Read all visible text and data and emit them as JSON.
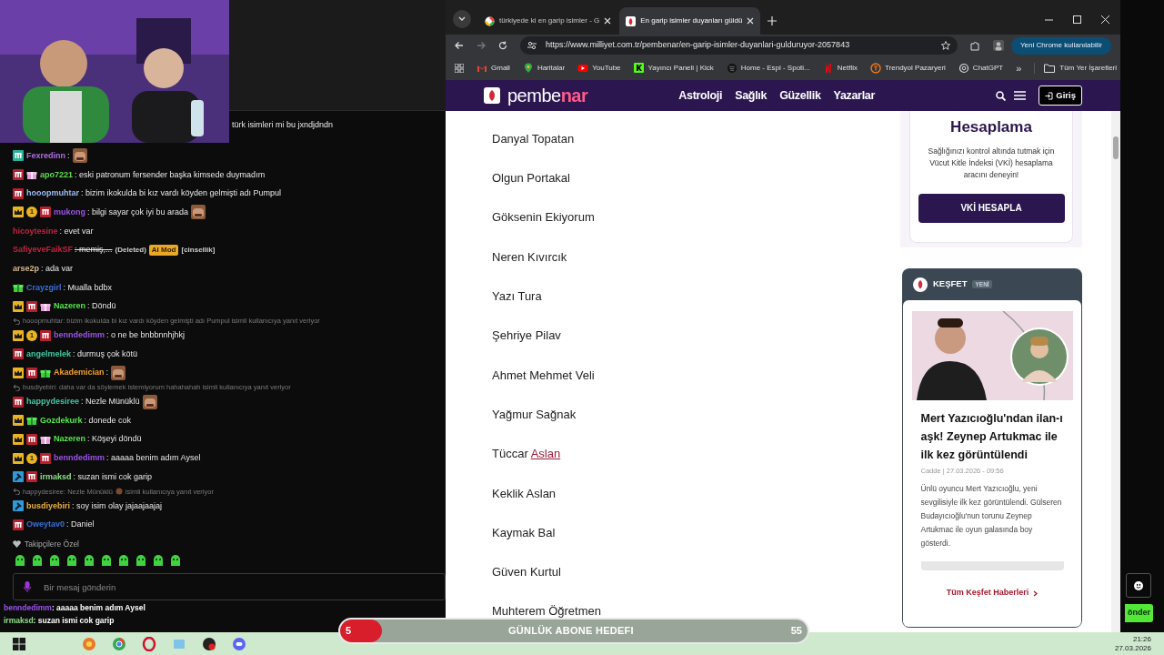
{
  "stream_chat": {
    "top_message": "türk isimleri mi bu jxndjdndn",
    "messages": [
      {
        "kind": "message",
        "badges": [
          {
            "kind": "sub-teal"
          }
        ],
        "user": "Fexredinn",
        "color": "#b06ee6",
        "text": ":",
        "emote": true
      },
      {
        "kind": "message",
        "badges": [
          {
            "kind": "sub"
          },
          {
            "kind": "gift-pink"
          }
        ],
        "user": "apo7221",
        "color": "#5dde4a",
        "text": ": eski patronum fersender başka kimsede duymadım"
      },
      {
        "kind": "message",
        "badges": [
          {
            "kind": "sub"
          }
        ],
        "user": "hooopmuhtar",
        "color": "#9bbcf0",
        "text": ": bizim ikokulda bi kız vardı köyden gelmişti adı Pumpul"
      },
      {
        "kind": "message",
        "badges": [
          {
            "kind": "crown"
          },
          {
            "kind": "count",
            "text": "1"
          },
          {
            "kind": "sub"
          }
        ],
        "user": "mukong",
        "color": "#9a54e8",
        "text": ": bilgi sayar çok iyi bu arada",
        "emote": true
      },
      {
        "kind": "message",
        "user": "hicoytesine",
        "color": "#c4223e",
        "text": ": evet var"
      },
      {
        "kind": "message",
        "user": "SafiyeveFaikSF",
        "color": "#c4223e",
        "text": ": memiş,...",
        "struck": true,
        "extras": [
          {
            "kind": "label",
            "text": "(Deleted)"
          },
          {
            "kind": "tag",
            "text": "AI Mod"
          },
          {
            "kind": "label",
            "text": "[cinsellik]"
          }
        ]
      },
      {
        "kind": "message",
        "user": "arse2p",
        "color": "#d7b98e",
        "text": ": ada var"
      },
      {
        "kind": "message",
        "badges": [
          {
            "kind": "gift-green"
          }
        ],
        "user": "Crayzgirl",
        "color": "#3b6fd6",
        "text": ": Mualla bdbx"
      },
      {
        "kind": "message",
        "badges": [
          {
            "kind": "crown"
          },
          {
            "kind": "sub"
          },
          {
            "kind": "gift-pink"
          }
        ],
        "user": "Nazeren",
        "color": "#54e84a",
        "text": ": Döndü"
      },
      {
        "kind": "reply",
        "text": "hooopmuhtar: bizim ikokulda bi kız vardı köyden gelmişti adı Pumpul isimli kullanıcıya yanıt veriyor"
      },
      {
        "kind": "message",
        "badges": [
          {
            "kind": "crown"
          },
          {
            "kind": "count",
            "text": "1"
          },
          {
            "kind": "sub"
          }
        ],
        "user": "benndedimm",
        "color": "#9a54e8",
        "text": ": o ne be bnbbnnhjhkj"
      },
      {
        "kind": "message",
        "badges": [
          {
            "kind": "sub"
          }
        ],
        "user": "angelmelek",
        "color": "#3fc9a0",
        "text": ": durmuş çok kötü"
      },
      {
        "kind": "message",
        "badges": [
          {
            "kind": "crown"
          },
          {
            "kind": "sub"
          },
          {
            "kind": "gift-green"
          }
        ],
        "user": "Akademician",
        "color": "#f0a030",
        "text": ":",
        "emote": true
      },
      {
        "kind": "reply",
        "text": "busdiyebiri: daha var da söylemek istemiyorum hahahahah isimli kullanıcıya yanıt veriyor"
      },
      {
        "kind": "message",
        "badges": [
          {
            "kind": "sub"
          }
        ],
        "user": "happydesiree",
        "color": "#3fc9a0",
        "text": ": Nezle Münüklü",
        "emote": true
      },
      {
        "kind": "message",
        "badges": [
          {
            "kind": "crown"
          },
          {
            "kind": "gift-green"
          }
        ],
        "user": "Gozdekurk",
        "color": "#54e84a",
        "text": ": donede cok"
      },
      {
        "kind": "message",
        "badges": [
          {
            "kind": "crown"
          },
          {
            "kind": "sub"
          },
          {
            "kind": "gift-pink"
          }
        ],
        "user": "Nazeren",
        "color": "#54e84a",
        "text": ": Köşeyi döndü"
      },
      {
        "kind": "message",
        "badges": [
          {
            "kind": "crown"
          },
          {
            "kind": "count",
            "text": "1"
          },
          {
            "kind": "sub"
          }
        ],
        "user": "benndedimm",
        "color": "#9a54e8",
        "text": ": aaaaa benim adım Aysel"
      },
      {
        "kind": "message",
        "badges": [
          {
            "kind": "mod"
          },
          {
            "kind": "sub"
          }
        ],
        "user": "irmaksd",
        "color": "#8ee08a",
        "text": ": suzan ismi cok garip"
      },
      {
        "kind": "reply",
        "text": "happydesiree: Nezle Münüklü",
        "emote": true,
        "after": "isimli kullanıcıya yanıt veriyor"
      },
      {
        "kind": "message",
        "badges": [
          {
            "kind": "mod"
          }
        ],
        "user": "busdiyebiri",
        "color": "#e8b040",
        "text": ": soy isim olay jajaajaajaj"
      },
      {
        "kind": "message",
        "badges": [
          {
            "kind": "sub"
          }
        ],
        "user": "Oweytav0",
        "color": "#3b6fd6",
        "text": ": Daniel"
      }
    ],
    "followers_label": "Takipçilere Özel",
    "input": {
      "placeholder": "Bir mesaj gönderin"
    },
    "overlay_lines": [
      {
        "user": "benndedimm",
        "color": "#9a54e8",
        "text": ": aaaaa benim adım Aysel"
      },
      {
        "user": "irmaksd",
        "color": "#8ee08a",
        "text": ": suzan ismi cok garip"
      }
    ]
  },
  "browser": {
    "tabs": [
      {
        "title": "türkiyede ki en garip isimler - G",
        "selected": false
      },
      {
        "title": "En garip isimler duyanları güldü",
        "selected": true
      }
    ],
    "url": "https://www.milliyet.com.tr/pembenar/en-garip-isimler-duyanlari-gulduruyor-2057843",
    "update_button": "Yeni Chrome kullanılabilir",
    "bookmarks": [
      "Gmail",
      "Haritalar",
      "YouTube",
      "Yayıncı Paneli | Kick",
      "Home - Espi - Spoti...",
      "Netflix",
      "Trendyol Pazaryeri",
      "ChatGPT"
    ],
    "more_bookmarks": "»",
    "all_bookmarks": "Tüm Yer İşaretleri"
  },
  "site": {
    "logo": "pembe",
    "logo_accent": "nar",
    "nav": [
      "Astroloji",
      "Sağlık",
      "Güzellik",
      "Yazarlar"
    ],
    "login": "Giriş",
    "names": [
      {
        "text": "Danyal Topatan"
      },
      {
        "text": "Olgun Portakal"
      },
      {
        "text": "Göksenin Ekiyorum"
      },
      {
        "text": "Neren Kıvırcık"
      },
      {
        "text": "Yazı Tura"
      },
      {
        "text": "Şehriye Pilav"
      },
      {
        "text": "Ahmet Mehmet Veli"
      },
      {
        "text": "Yağmur Sağnak"
      },
      {
        "text": "Tüccar",
        "link": "Aslan"
      },
      {
        "text": "Keklik Aslan"
      },
      {
        "text": "Kaymak Bal"
      },
      {
        "text": "Güven Kurtul"
      },
      {
        "text": "Muhterem Öğretmen"
      }
    ],
    "bmi_card": {
      "title": "Hesaplama",
      "text": "Sağlığınızı kontrol altında tutmak için Vücut Kitle İndeksi (VKİ) hesaplama aracını deneyin!",
      "button": "VKİ HESAPLA"
    },
    "discover": {
      "title": "KEŞFET",
      "badge": "YENİ",
      "headline": "Mert Yazıcıoğlu'ndan ilan-ı aşk! Zeynep Artukmac ile ilk kez görüntülendi",
      "meta": "Cadde | 27.03.2026 - 09:56",
      "summary": "Ünlü oyuncu Mert Yazıcıoğlu, yeni sevgilisiyle ilk kez görüntülendi. Gülseren Budayıcıoğlu'nun torunu Zeynep Artukmac ile oyun galasında boy gösterdi.",
      "link": "Tüm Keşfet Haberleri"
    }
  },
  "side_controls": {
    "send_button": "önder"
  },
  "sub_goal": {
    "current": "5",
    "label": "GÜNLÜK ABONE HEDEFI",
    "target": "55",
    "level": 0.09
  },
  "taskbar": {
    "time": "21:26",
    "date": "27.03.2026"
  }
}
